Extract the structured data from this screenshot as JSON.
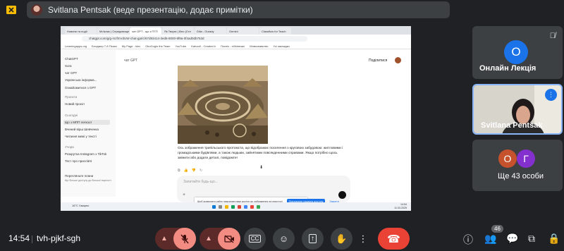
{
  "presenter": {
    "text": "Svitlana Pentsak (веде презентацію, додає примітки)"
  },
  "screen": {
    "tabs": [
      "Новини та події",
      "Моїклас | Середовище",
      "чат GPT - що з ПТП",
      "Як Творю | Кінo (Сте",
      "Diiia - Gurady",
      "Gemini",
      "Classflow for Teach"
    ],
    "address": "chatgpt.com/g/g-mzfmVdUW-chat-gpt/c/67d93414-3ed6-8000-8f9a-0f4ad0db753d",
    "bookmarks": [
      "Learningapps.org",
      "Блоджер 7-8 Пішиз",
      "My Page - kiev",
      "OkoGuglo ths Team",
      "YouTube",
      "Kahoot! - Created k",
      "Поспіх - п/i/kінезис",
      "Мовознавство",
      "Усі закладки"
    ],
    "sidebar": {
      "items": [
        "ChatGPT",
        "Sora",
        "чат GPT",
        "Українська інформа...",
        "Ознайомитися з GPT"
      ],
      "projects_head": "Проєкти",
      "new_project": "Новий проєкт",
      "today_head": "Сьогодні",
      "today_items": [
        "Що з МПП легкоот",
        "Вчений вірш Шевченка",
        "Читання межі у тексті"
      ],
      "week_head": "Учора",
      "week_items": [
        "Розкрутка Instagram з TikTok",
        "Тест про прислів'я"
      ],
      "upgrade_label": "Перегляньте плани",
      "upgrade_sub": "Ще більше доступу до більшої вартості"
    },
    "chat_title": "чат GPT",
    "share_label": "Поділитися",
    "response": "Ось зображення трипільського протомста, що відображає поселення з круговою забудовою: житловими і громадськими будівлями, а також людьми, зайнятими повсякденними справами. Якщо потрібно щось змінити або додати деталі, повідомте!",
    "input_placeholder": "Запитайте будь-що...",
    "notice": {
      "text": "Щоб дозволити сайту надсилати вам доступ до зображення на пристрої",
      "button": "Призначити надання доступу",
      "close": "Закрити"
    },
    "weather": "16°C Хмарно",
    "tray_time": "14:54",
    "tray_date": "11.03.2025"
  },
  "tiles": {
    "lecture": {
      "initial": "О",
      "name": "Онлайн Лекція"
    },
    "presenter": {
      "name": "Svitlana Pentsak"
    },
    "others": {
      "initials": [
        "О",
        "Г"
      ],
      "label": "Ще 43 особи"
    }
  },
  "bottom": {
    "time": "14:54",
    "code": "tvh-pjkf-sgh",
    "participants_badge": "46"
  },
  "colors": {
    "background": "#202124",
    "tile": "#3c4043",
    "end_call": "#ea4335",
    "accent": "#8ab4f8",
    "avatar_blue": "#1a73e8",
    "avatar_orange": "#c5522d",
    "avatar_purple": "#8430ce"
  }
}
